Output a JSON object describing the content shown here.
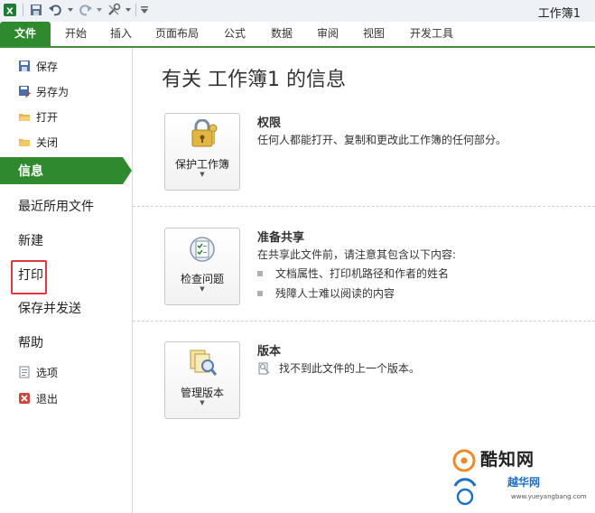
{
  "window": {
    "title": "工作簿1"
  },
  "colors": {
    "accent": "#2f8a2f",
    "highlight_box": "#e0383e",
    "watermark_blue": "#1d6fc4"
  },
  "quick_access": {
    "icons": [
      "excel-logo-icon",
      "save-icon",
      "undo-icon",
      "redo-icon",
      "tools-icon",
      "customize-icon"
    ]
  },
  "ribbon": {
    "tabs": [
      "文件",
      "开始",
      "插入",
      "页面布局",
      "公式",
      "数据",
      "审阅",
      "视图",
      "开发工具"
    ],
    "active_tab": "文件"
  },
  "sidebar": {
    "save": "保存",
    "save_as": "另存为",
    "open": "打开",
    "close": "关闭",
    "info": "信息",
    "recent": "最近所用文件",
    "new": "新建",
    "print": "打印",
    "save_send": "保存并发送",
    "help": "帮助",
    "options": "选项",
    "exit": "退出"
  },
  "main": {
    "title": "有关 工作簿1 的信息",
    "permissions": {
      "button": "保护工作簿",
      "heading": "权限",
      "desc": "任何人都能打开、复制和更改此工作簿的任何部分。"
    },
    "prepare": {
      "button": "检查问题",
      "heading": "准备共享",
      "desc": "在共享此文件前，请注意其包含以下内容:",
      "bullets": [
        "文档属性、打印机路径和作者的姓名",
        "残障人士难以阅读的内容"
      ]
    },
    "versions": {
      "button": "管理版本",
      "heading": "版本",
      "desc": "找不到此文件的上一个版本。"
    },
    "caret": "▼"
  },
  "watermark": {
    "brand": "酷知网",
    "brand2": "越华网",
    "url": "www.yueyangbang.com"
  }
}
